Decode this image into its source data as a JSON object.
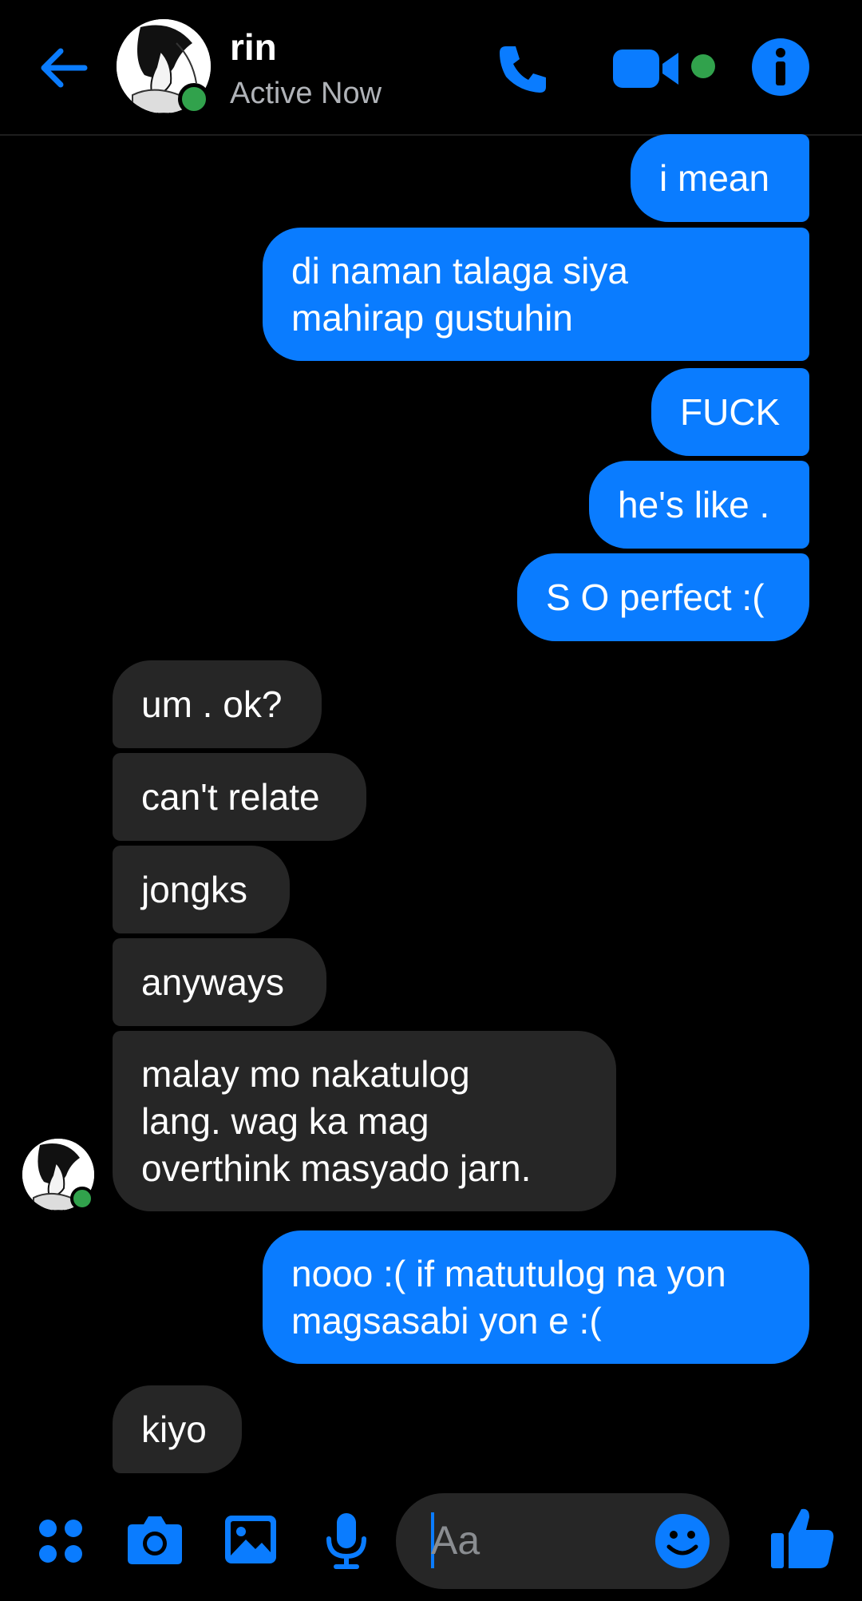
{
  "header": {
    "contact_name": "rin",
    "status": "Active Now"
  },
  "messages": [
    {
      "side": "out",
      "text": "i mean"
    },
    {
      "side": "out",
      "text": "di naman talaga siya\nmahirap gustuhin"
    },
    {
      "side": "out",
      "text": "FUCK"
    },
    {
      "side": "out",
      "text": "he's like ."
    },
    {
      "side": "out",
      "text": "S O perfect :("
    },
    {
      "side": "in",
      "text": "um . ok?"
    },
    {
      "side": "in",
      "text": "can't relate"
    },
    {
      "side": "in",
      "text": "jongks"
    },
    {
      "side": "in",
      "text": "anyways"
    },
    {
      "side": "in",
      "text": "malay mo nakatulog\nlang. wag ka mag\noverthink masyado jarn."
    },
    {
      "side": "out",
      "text": "nooo :( if matutulog na yon\nmagsasabi yon e :("
    },
    {
      "side": "in",
      "text": "kiyo"
    }
  ],
  "composer": {
    "placeholder": "Aa"
  },
  "colors": {
    "accent": "#0a7cff",
    "incoming_bubble": "#262626",
    "online": "#31a24c",
    "background": "#000000"
  },
  "icons": [
    "back-arrow-icon",
    "phone-icon",
    "video-camera-icon",
    "info-icon",
    "apps-grid-icon",
    "camera-icon",
    "gallery-icon",
    "microphone-icon",
    "emoji-icon",
    "thumbs-up-icon"
  ]
}
